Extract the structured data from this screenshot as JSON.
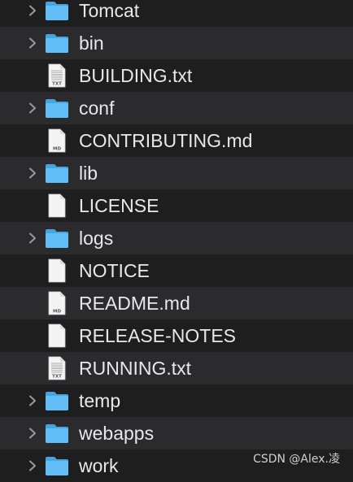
{
  "items": [
    {
      "label": "Tomcat",
      "type": "folder",
      "expandable": true
    },
    {
      "label": "bin",
      "type": "folder",
      "expandable": true
    },
    {
      "label": "BUILDING.txt",
      "type": "txt",
      "expandable": false,
      "badge": "TXT"
    },
    {
      "label": "conf",
      "type": "folder",
      "expandable": true
    },
    {
      "label": "CONTRIBUTING.md",
      "type": "md",
      "expandable": false,
      "badge": "MD"
    },
    {
      "label": "lib",
      "type": "folder",
      "expandable": true
    },
    {
      "label": "LICENSE",
      "type": "doc",
      "expandable": false
    },
    {
      "label": "logs",
      "type": "folder",
      "expandable": true
    },
    {
      "label": "NOTICE",
      "type": "doc",
      "expandable": false
    },
    {
      "label": "README.md",
      "type": "md",
      "expandable": false,
      "badge": "MD"
    },
    {
      "label": "RELEASE-NOTES",
      "type": "doc",
      "expandable": false
    },
    {
      "label": "RUNNING.txt",
      "type": "txt",
      "expandable": false,
      "badge": "TXT"
    },
    {
      "label": "temp",
      "type": "folder",
      "expandable": true
    },
    {
      "label": "webapps",
      "type": "folder",
      "expandable": true
    },
    {
      "label": "work",
      "type": "folder",
      "expandable": true
    }
  ],
  "watermark": "CSDN @Alex.凌",
  "colors": {
    "folder": "#5cb6f0",
    "folder_tab": "#4aa3e0",
    "doc": "#f2f2f2",
    "chevron": "#9a9a9a"
  }
}
